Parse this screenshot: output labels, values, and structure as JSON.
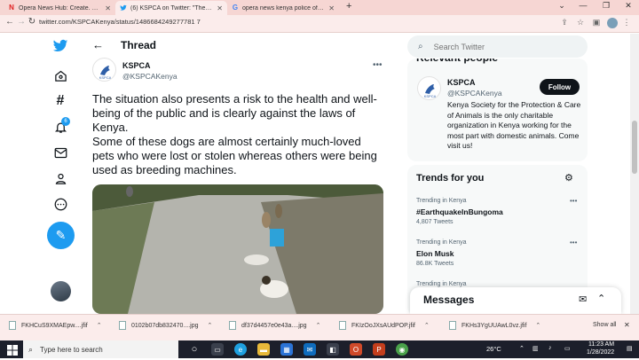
{
  "browser": {
    "tabs": [
      {
        "title": "Opera News Hub: Create. Share.",
        "icon": "N",
        "icon_color": "#e02020",
        "active": false
      },
      {
        "title": "(6) KSPCA on Twitter: \"The situati",
        "icon": "bird",
        "icon_color": "#1d9bf0",
        "active": true
      },
      {
        "title": "opera news kenya police officers",
        "icon": "G",
        "icon_color": "#4285f4",
        "active": false
      }
    ],
    "new_tab": "+",
    "url": "twitter.com/KSPCAKenya/status/1486684249277781 7",
    "window_controls": [
      "⌄",
      "—",
      "❐",
      "✕"
    ]
  },
  "twitter": {
    "nav_icons": [
      "twitter-logo-icon",
      "explore-icon",
      "hashtag-icon",
      "notifications-icon",
      "messages-icon",
      "profile-icon",
      "more-icon"
    ],
    "notification_count": "6",
    "header_title": "Thread",
    "tweet": {
      "author_name": "KSPCA",
      "author_handle": "@KSPCAKenya",
      "text_p1": "The situation also presents a risk to the health and well-being of the public and is clearly against the laws of Kenya.",
      "text_p2": "Some of these dogs are almost certainly much-loved pets who were lost or stolen whereas others were being used as breeding machines."
    },
    "search_placeholder": "Search Twitter",
    "relevant": {
      "heading": "Relevant people",
      "name": "KSPCA",
      "handle": "@KSPCAKenya",
      "follow_label": "Follow",
      "bio": "Kenya Society for the Protection & Care of Animals is the only charitable organization in Kenya working for the most part with domestic animals. Come visit us!"
    },
    "trends": {
      "heading": "Trends for you",
      "items": [
        {
          "meta": "Trending in Kenya",
          "name": "#EarthquakeInBungoma",
          "count": "4,807 Tweets"
        },
        {
          "meta": "Trending in Kenya",
          "name": "Elon Musk",
          "count": "86.8K Tweets"
        },
        {
          "meta": "Trending in Kenya",
          "name": "",
          "count": ""
        }
      ]
    },
    "messages_title": "Messages"
  },
  "downloads": {
    "items": [
      "FKHCuS9XMAEpw....jfif",
      "0102b07db832470....jpg",
      "df37d4457e0e43a....jpg",
      "FKIzOoJXsAUdPOP.jfif",
      "FKHs3YgUUAwL0vz.jfif"
    ],
    "show_all": "Show all",
    "close": "✕"
  },
  "taskbar": {
    "search_placeholder": "Type here to search",
    "weather": "26°C",
    "time": "11:23 AM",
    "date": "1/28/2022"
  }
}
